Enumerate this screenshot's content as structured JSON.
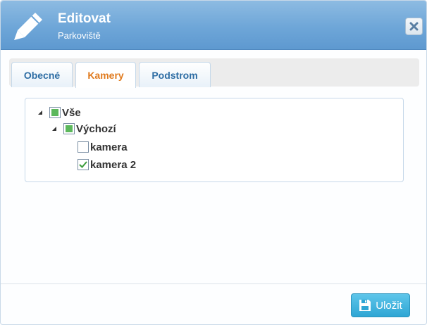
{
  "header": {
    "title": "Editovat",
    "subtitle": "Parkoviště",
    "icon": "pencil-icon",
    "close_icon": "close-icon"
  },
  "tabs": [
    {
      "label": "Obecné",
      "active": false
    },
    {
      "label": "Kamery",
      "active": true
    },
    {
      "label": "Podstrom",
      "active": false
    }
  ],
  "tree": {
    "root": {
      "label": "Vše",
      "state": "partial",
      "expanded": true
    },
    "group": {
      "label": "Výchozí",
      "state": "partial",
      "expanded": true
    },
    "items": [
      {
        "label": "kamera",
        "checked": false
      },
      {
        "label": "kamera 2",
        "checked": true
      }
    ]
  },
  "footer": {
    "save_label": "Uložit",
    "save_icon": "save-icon"
  },
  "colors": {
    "header": "#6ea6d8",
    "active_tab_text": "#e07b1f",
    "tab_text": "#2e6da4",
    "check_fill": "#5cb85c",
    "save_button": "#2ea6d4"
  }
}
